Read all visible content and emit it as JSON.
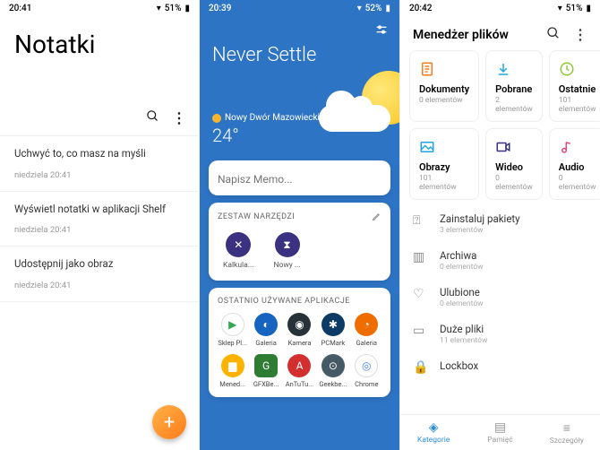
{
  "panel1": {
    "status": {
      "time": "20:41",
      "battery": "51%"
    },
    "title": "Notatki",
    "notes": [
      {
        "title": "Uchwyć to, co masz na myśli",
        "meta": "niedziela 20:41"
      },
      {
        "title": "Wyświetl notatki w aplikacji Shelf",
        "meta": "niedziela 20:41"
      },
      {
        "title": "Udostępnij jako obraz",
        "meta": "niedziela 20:41"
      }
    ],
    "fab": "+"
  },
  "panel2": {
    "status": {
      "time": "20:39",
      "battery": "52%"
    },
    "brand": "Never Settle",
    "weather": {
      "location": "Nowy Dwór Mazowiecki",
      "cond": "Słonecznie",
      "temp": "24°"
    },
    "memo_placeholder": "Napisz Memo...",
    "toolkit": {
      "header": "ZESTAW NARZĘDZI",
      "items": [
        "Kalkula...",
        "Nowy ..."
      ]
    },
    "recent": {
      "header": "OSTATNIO UŻYWANE APLIKACJE",
      "apps": [
        {
          "label": "Sklep Pl...",
          "color": "#ffffff",
          "glyph": "▶",
          "fg": "#34a853"
        },
        {
          "label": "Galeria",
          "color": "#1565c0",
          "glyph": "◐"
        },
        {
          "label": "Kamera",
          "color": "#263238",
          "glyph": "◉"
        },
        {
          "label": "PCMark",
          "color": "#0d3b66",
          "glyph": "✱"
        },
        {
          "label": "Galeria",
          "color": "#ef6c00",
          "glyph": "◔"
        },
        {
          "label": "Mened...",
          "color": "#ffb300",
          "glyph": "▆"
        },
        {
          "label": "GFXBe...",
          "color": "#2e7d32",
          "glyph": "G",
          "square": true
        },
        {
          "label": "AnTuTu...",
          "color": "#d32f2f",
          "glyph": "A"
        },
        {
          "label": "Geekbe...",
          "color": "#455a64",
          "glyph": "⊙"
        },
        {
          "label": "Chrome",
          "color": "#ffffff",
          "glyph": "◎",
          "fg": "#4285f4"
        }
      ]
    }
  },
  "panel3": {
    "status": {
      "time": "20:42",
      "battery": "51%"
    },
    "title": "Menedżer plików",
    "categories": [
      {
        "label": "Dokumenty",
        "count": "0 elementów",
        "icon": "doc",
        "color": "#ff7a1a"
      },
      {
        "label": "Pobrane",
        "count": "2 elementów",
        "icon": "download",
        "color": "#1ea7e0"
      },
      {
        "label": "Ostatnie",
        "count": "101 elementów",
        "icon": "clock",
        "color": "#8fc93a"
      },
      {
        "label": "Obrazy",
        "count": "101 elementów",
        "icon": "image",
        "color": "#1ea7e0"
      },
      {
        "label": "Wideo",
        "count": "0 elementów",
        "icon": "video",
        "color": "#3a3180"
      },
      {
        "label": "Audio",
        "count": "0 elementów",
        "icon": "audio",
        "color": "#e8467a"
      }
    ],
    "list": [
      {
        "label": "Zainstaluj pakiety",
        "count": "3 elementów",
        "icon": "android"
      },
      {
        "label": "Archiwa",
        "count": "0 elementów",
        "icon": "archive"
      },
      {
        "label": "Ulubione",
        "count": "0 elementów",
        "icon": "heart"
      },
      {
        "label": "Duże pliki",
        "count": "11 elementów",
        "icon": "large"
      },
      {
        "label": "Lockbox",
        "count": "",
        "icon": "lock"
      }
    ],
    "tabs": [
      {
        "label": "Kategorie",
        "active": true
      },
      {
        "label": "Pamięć",
        "active": false
      },
      {
        "label": "Szczegóły",
        "active": false
      }
    ]
  }
}
